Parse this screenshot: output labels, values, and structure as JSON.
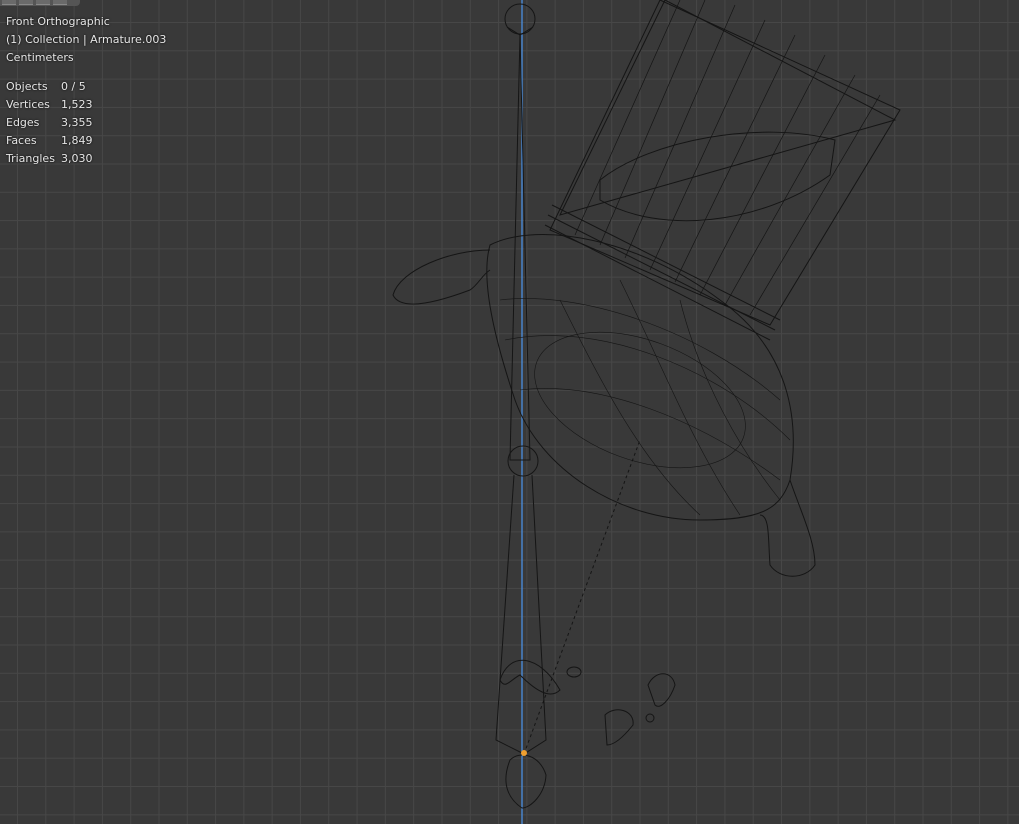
{
  "viewport": {
    "view_name": "Front Orthographic",
    "collection_info": "(1) Collection | Armature.003",
    "units": "Centimeters",
    "stats": [
      {
        "label": "Objects",
        "value": "0 / 5"
      },
      {
        "label": "Vertices",
        "value": "1,523"
      },
      {
        "label": "Edges",
        "value": "3,355"
      },
      {
        "label": "Faces",
        "value": "1,849"
      },
      {
        "label": "Triangles",
        "value": "3,030"
      }
    ],
    "colors": {
      "background": "#393939",
      "grid": "#474747",
      "z_axis": "#4a8fe0",
      "wire": "#111111",
      "origin": "#f0a030"
    }
  }
}
